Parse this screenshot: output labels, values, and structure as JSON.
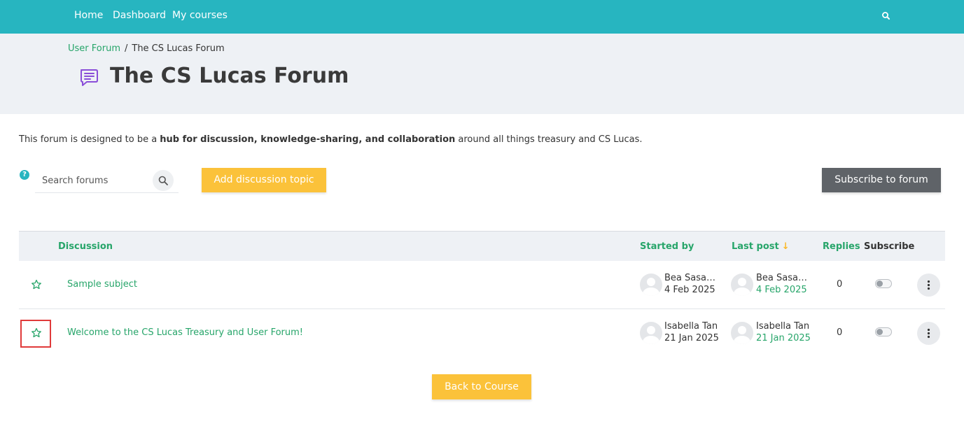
{
  "nav": {
    "home": "Home",
    "dashboard": "Dashboard",
    "my_courses": "My courses",
    "search_icon": "search-icon",
    "color": "#27b5c0"
  },
  "breadcrumb": {
    "parent": "User Forum",
    "separator": "/",
    "current": "The CS Lucas Forum"
  },
  "page": {
    "title": "The CS Lucas Forum",
    "icon": "forum-chat-icon"
  },
  "intro": {
    "before": "This forum is designed to be a ",
    "bold": "hub for discussion, knowledge-sharing, and collaboration",
    "after": " around all things treasury and CS Lucas."
  },
  "toolbar": {
    "help": "?",
    "search_placeholder": "Search forums",
    "add_topic": "Add discussion topic",
    "subscribe": "Subscribe to forum"
  },
  "table": {
    "headers": {
      "discussion": "Discussion",
      "started_by": "Started by",
      "last_post": "Last post",
      "last_post_sort": "↓",
      "replies": "Replies",
      "subscribe": "Subscribe"
    },
    "rows": [
      {
        "subject": "Sample subject",
        "starter_name": "Bea Sasam...",
        "starter_date": "4 Feb 2025",
        "last_name": "Bea Sasam...",
        "last_date": "4 Feb 2025",
        "replies": "0",
        "subscribed": false,
        "starred": false
      },
      {
        "subject": "Welcome to the CS Lucas Treasury and User Forum!",
        "starter_name": "Isabella Tan",
        "starter_date": "21 Jan 2025",
        "last_name": "Isabella Tan",
        "last_date": "21 Jan 2025",
        "replies": "0",
        "subscribed": false,
        "starred": false
      }
    ]
  },
  "footer": {
    "back": "Back to Course"
  },
  "colors": {
    "accent_green": "#27a56a",
    "button_yellow": "#fbc23a",
    "button_dark": "#5f6368",
    "highlight_red": "#e03a3a"
  }
}
